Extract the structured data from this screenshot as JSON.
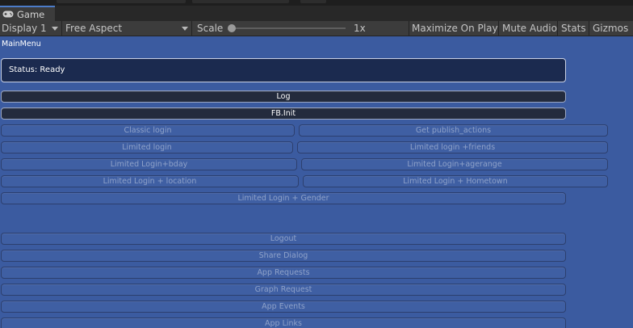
{
  "tab": {
    "title": "Game",
    "icon": "gamepad-icon"
  },
  "toolbar": {
    "display": "Display 1",
    "aspect": "Free Aspect",
    "scale_label": "Scale",
    "scale_value": "1x",
    "maximize": "Maximize On Play",
    "mute": "Mute Audio",
    "stats": "Stats",
    "gizmos": "Gizmos"
  },
  "game": {
    "menu_label": "MainMenu",
    "status": "Status: Ready",
    "buttons": {
      "log": "Log",
      "fb_init": "FB.Init",
      "classic_login": "Classic login",
      "publish_actions": "Get publish_actions",
      "limited_login": "Limited login",
      "limited_friends": "Limited login +friends",
      "limited_bday": "Limited Login+bday",
      "limited_agerange": "Limited Login+agerange",
      "limited_location": "Limited Login + location",
      "limited_hometown": "Limited Login + Hometown",
      "limited_gender": "Limited Login + Gender",
      "logout": "Logout",
      "share_dialog": "Share Dialog",
      "app_requests": "App Requests",
      "graph_request": "Graph Request",
      "app_events": "App Events",
      "app_links": "App Links"
    }
  },
  "colors": {
    "game_bg": "#3b5ba0",
    "button_bg": "#3f5fa3",
    "button_text_disabled": "#8fa2c9",
    "status_bg": "#1b2a4f",
    "editor_bg": "#3c3c3c",
    "tab_accent": "#4c7cc9"
  }
}
